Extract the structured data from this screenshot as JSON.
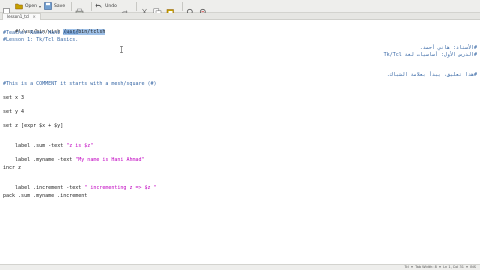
{
  "toolbar": {
    "new_icon": "new-document-icon",
    "open_label": "Open",
    "save_label": "Save",
    "print_icon": "print-icon",
    "undo_label": "Undo",
    "redo_icon": "redo-icon",
    "cut_icon": "cut-icon",
    "copy_icon": "copy-icon",
    "paste_icon": "paste-icon",
    "find_icon": "search-icon",
    "replace_icon": "search-replace-icon"
  },
  "tabs": [
    {
      "label": "lesson1_tcl"
    }
  ],
  "editor": {
    "shebang_prefix": "#!/usr/bin/wish ",
    "shebang_selected": "/usr/bin/tclsh",
    "comment_teacher": "#Teacher Name: Hani Ahmad",
    "comment_lesson": "#Lesson 1: Tk/Tcl Basics.",
    "rtl_line1": "#الأستاذ: هاني أحمد.",
    "rtl_line2": "#الدرس الأول: أساسيات لغة Tk/Tcl",
    "rtl_line3": "#هذا تعليق، يبدأ بعلامة الشباك.",
    "comment_hash": "#This is a COMMENT it starts with a mesh/square (#)",
    "line_set_x": "set x 3",
    "line_set_y": "set y 4",
    "line_set_z": "set z [expr $x + $y]",
    "label_sum_cmd": "label .sum -text ",
    "label_sum_str": "\"z is $z\"",
    "label_myname_cmd": "label .myname -text ",
    "label_myname_str": "\"My name is Hani Ahmad\"",
    "line_incr": "incr z",
    "label_incr_cmd": "label .increment -text ",
    "label_incr_str": "\" incrementing z => $z \"",
    "line_pack": "pack .sum .myname .increment"
  },
  "statusbar": {
    "position": "Tcl  ▾  Tab Width: 8  ▾  Ln 1, Col 31  ▾  INS"
  }
}
